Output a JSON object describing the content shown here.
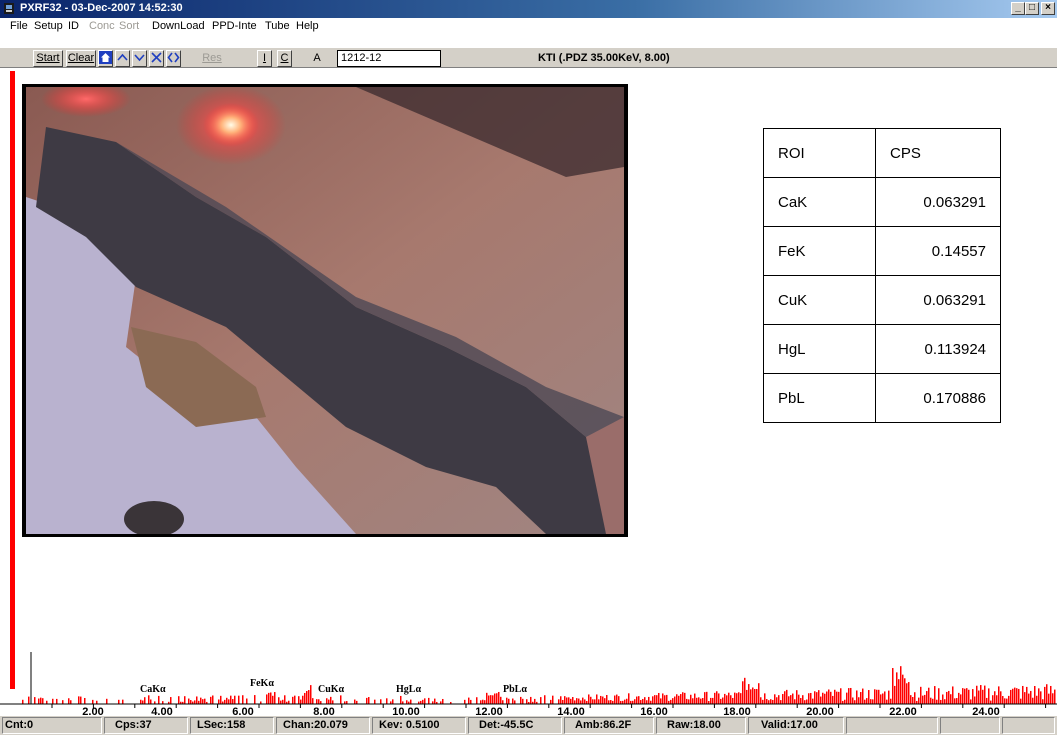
{
  "window": {
    "title": "PXRF32 - 03-Dec-2007 14:52:30",
    "controls": [
      "_",
      "□",
      "×"
    ]
  },
  "menu": [
    {
      "label": "File",
      "enabled": true
    },
    {
      "label": "Setup",
      "enabled": true
    },
    {
      "label": "ID",
      "enabled": true
    },
    {
      "label": "Conc",
      "enabled": false
    },
    {
      "label": "Sort",
      "enabled": false
    },
    {
      "label": "DownLoad",
      "enabled": true
    },
    {
      "label": "PPD-Inte",
      "enabled": true
    },
    {
      "label": "Tube",
      "enabled": true
    },
    {
      "label": "Help",
      "enabled": true
    }
  ],
  "toolbar": {
    "start": "Start",
    "clear": "Clear",
    "res": "Res",
    "i": "I",
    "c": "C",
    "a": "A",
    "id_value": "1212-12",
    "info": "KTI (.PDZ 35.00KeV, 8.00)"
  },
  "roi_table": {
    "headers": [
      "ROI",
      "CPS"
    ],
    "rows": [
      {
        "roi": "CaK",
        "cps": "0.063291"
      },
      {
        "roi": "FeK",
        "cps": "0.14557"
      },
      {
        "roi": "CuK",
        "cps": "0.063291"
      },
      {
        "roi": "HgL",
        "cps": "0.113924"
      },
      {
        "roi": "PbL",
        "cps": "0.170886"
      }
    ]
  },
  "spectrum": {
    "accent": "#ff0000",
    "axis_ticks": [
      "2.00",
      "4.00",
      "6.00",
      "8.00",
      "10.00",
      "12.00",
      "14.00",
      "16.00",
      "18.00",
      "20.00",
      "22.00",
      "24.00"
    ],
    "peak_labels": [
      "CaKα",
      "FeKα",
      "CuKα",
      "HgLα",
      "PbLα"
    ]
  },
  "status": {
    "cnt": "Cnt:0",
    "cps": "Cps:37",
    "lsec": "LSec:158",
    "chan": "Chan:20.079",
    "kev": "Kev: 0.5100",
    "det": "Det:-45.5C",
    "amb": "Amb:86.2F",
    "raw": "Raw:18.00",
    "valid": "Valid:17.00"
  }
}
